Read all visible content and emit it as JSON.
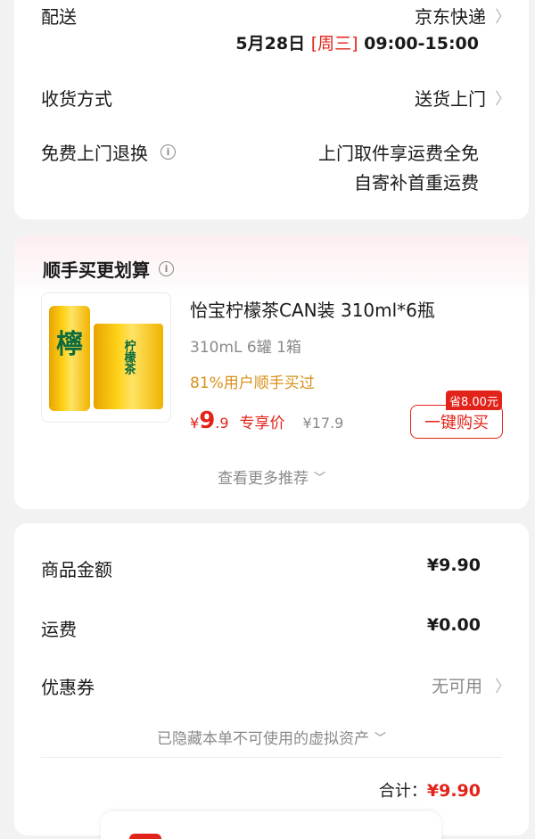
{
  "delivery": {
    "label": "配送",
    "carrier": "京东快递",
    "date": "5月28日",
    "weekday": "[周三]",
    "time_window": "09:00-15:00"
  },
  "receive": {
    "label": "收货方式",
    "value": "送货上门"
  },
  "returns": {
    "label": "免费上门退换",
    "line1": "上门取件享运费全免",
    "line2": "自寄补首重运费"
  },
  "recommend": {
    "title": "顺手买更划算",
    "product": {
      "name": "怡宝柠檬茶CAN装 310ml*6瓶",
      "spec": "310mL 6罐 1箱",
      "social_proof": "81%用户顺手买过",
      "currency": "¥",
      "price_int": "9",
      "price_dec": ".9",
      "price_tag": "专享价",
      "original_price": "¥17.9",
      "save_tag": "省8.00元",
      "buy_label": "一键购买",
      "can_brand_char": "檸",
      "box_text": "柠檬茶"
    },
    "more_label": "查看更多推荐"
  },
  "summary": {
    "goods_label": "商品金额",
    "goods_value": "¥9.90",
    "shipping_label": "运费",
    "shipping_value": "¥0.00",
    "coupon_label": "优惠券",
    "coupon_value": "无可用",
    "hidden_assets": "已隐藏本单不可使用的虚拟资产",
    "total_label": "合计：",
    "total_value": "¥9.90"
  },
  "colors": {
    "accent": "#e2231a",
    "background": "#f2f2f2"
  }
}
